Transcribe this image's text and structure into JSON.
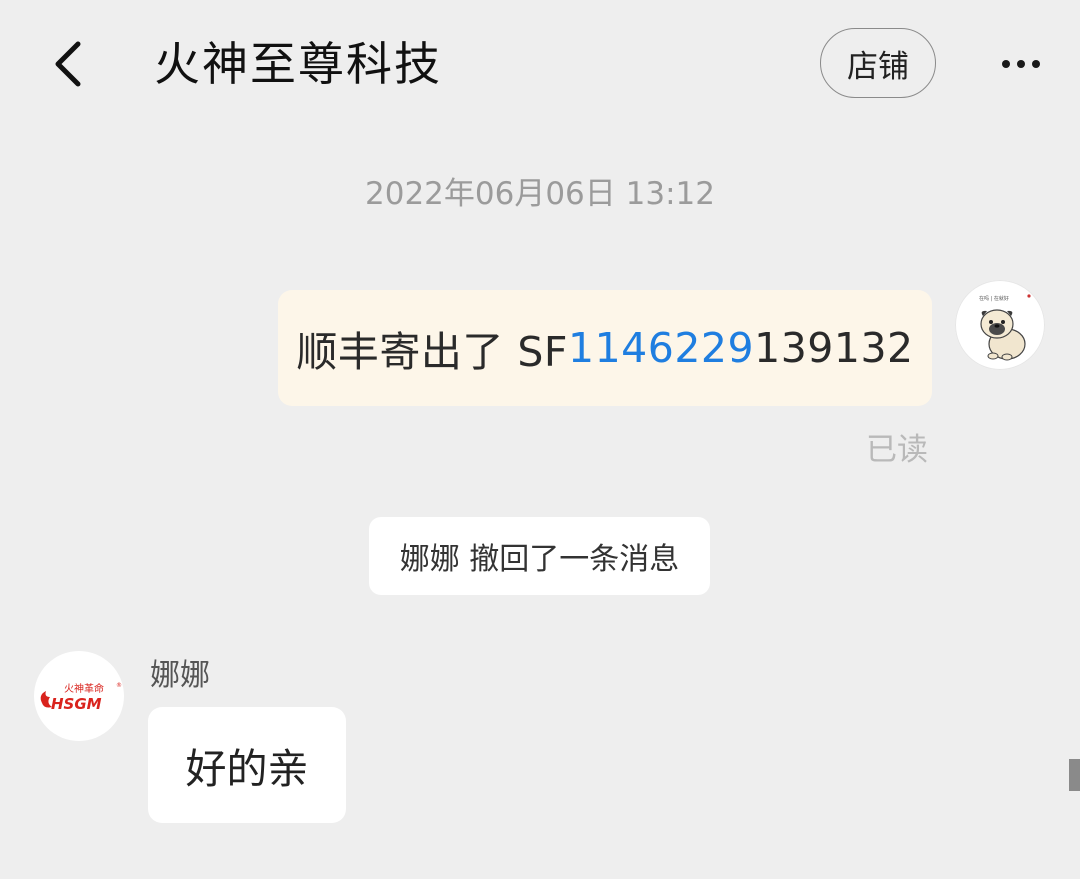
{
  "header": {
    "title": "火神至尊科技",
    "shop_button": "店铺"
  },
  "messages": {
    "timestamp": "2022年06月06日 13:12",
    "outgoing": {
      "prefix": "顺丰寄出了 SF",
      "tracking_link": "1146229",
      "suffix": "139132",
      "status": "已读"
    },
    "recall_notice": "娜娜 撤回了一条消息",
    "incoming": {
      "sender": "娜娜",
      "text": "好的亲"
    }
  },
  "avatars": {
    "my_avatar_caption": "在吗 | 在就好",
    "shop_logo_top": "火神革命",
    "shop_logo_brand": "HSGM"
  },
  "colors": {
    "background": "#eeeeee",
    "outgoing_bubble": "#fdf6e9",
    "link": "#1f7ee0",
    "brand_red": "#d9231d"
  }
}
